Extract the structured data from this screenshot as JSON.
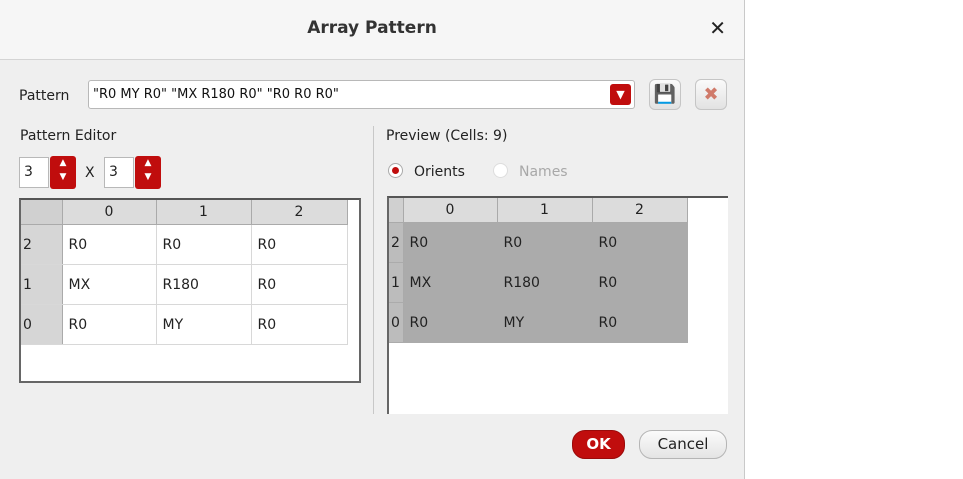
{
  "dialog": {
    "title": "Array Pattern"
  },
  "pattern": {
    "label": "Pattern",
    "value": "\"R0 MY R0\" \"MX R180 R0\" \"R0 R0 R0\""
  },
  "editor": {
    "label": "Pattern Editor",
    "rows_value": "3",
    "x_label": "X",
    "cols_value": "3",
    "columns": [
      "0",
      "1",
      "2"
    ],
    "rows": [
      {
        "index": "2",
        "cells": [
          "R0",
          "R0",
          "R0"
        ]
      },
      {
        "index": "1",
        "cells": [
          "MX",
          "R180",
          "R0"
        ]
      },
      {
        "index": "0",
        "cells": [
          "R0",
          "MY",
          "R0"
        ]
      }
    ]
  },
  "preview": {
    "label": "Preview (Cells: 9)",
    "radio_orients": "Orients",
    "radio_names": "Names",
    "selected": "Orients",
    "columns": [
      "0",
      "1",
      "2"
    ],
    "rows": [
      {
        "index": "2",
        "cells": [
          "R0",
          "R0",
          "R0"
        ]
      },
      {
        "index": "1",
        "cells": [
          "MX",
          "R180",
          "R0"
        ]
      },
      {
        "index": "0",
        "cells": [
          "R0",
          "MY",
          "R0"
        ]
      }
    ]
  },
  "buttons": {
    "ok": "OK",
    "cancel": "Cancel"
  },
  "colors": {
    "accent": "#c00d0d",
    "dialog_bg": "#efefef"
  }
}
